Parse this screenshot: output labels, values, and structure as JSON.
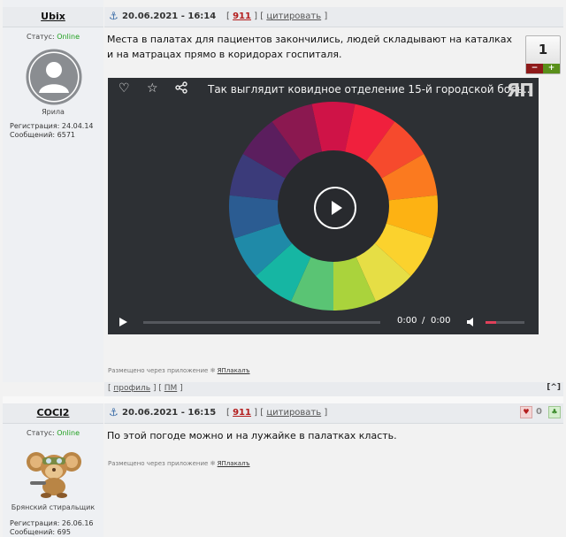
{
  "post1": {
    "nick": "Ubix",
    "status_label": "Статус:",
    "status_value": "Online",
    "rank": "Ярила",
    "reg_label": "Регистрация: 24.04.14",
    "msgs_label": "Сообщений: 6571",
    "date": "20.06.2021 - 16:14",
    "num": "911",
    "cite": "цитировать",
    "text": "Места в палатах для пациентов закончились, людей складывают на каталках и на матрацах прямо в коридорах госпиталя.",
    "rating": "1",
    "minus": "−",
    "plus": "+",
    "video": {
      "title": "Так выглядит ковидное отделение 15-й городской боль...",
      "logo": "ЯП",
      "time_current": "0:00",
      "time_sep": "/",
      "time_total": "0:00",
      "icons": [
        "heart-icon",
        "star-icon",
        "share-icon",
        "play-icon",
        "volume-icon",
        "fullscreen-icon"
      ]
    },
    "posted_via_prefix": "Размещено через приложение",
    "app_name": "ЯПлакалъ",
    "footer_profile": "профиль",
    "footer_pm": "ПМ",
    "up": "[^]"
  },
  "post2": {
    "nick": "COCl2",
    "status_label": "Статус:",
    "status_value": "Online",
    "rank": "Брянский стиральщик",
    "reg_label": "Регистрация: 26.06.16",
    "msgs_label": "Сообщений: 695",
    "date": "20.06.2021 - 16:15",
    "num": "911",
    "cite": "цитировать",
    "text": "По этой погоде можно и на лужайке в палатках класть.",
    "rating": "0",
    "posted_via_prefix": "Размещено через приложение",
    "app_name": "ЯПлакалъ"
  },
  "colors": {
    "online": "#21a121",
    "link_red": "#b31d1d",
    "video_bg": "#2d3034",
    "wheel": [
      "#cf1347",
      "#f0203d",
      "#f64a2d",
      "#fb7a1f",
      "#fdb213",
      "#fbd22d",
      "#e6de45",
      "#aad33c",
      "#5ac474",
      "#16b6a3",
      "#1f8aa8",
      "#2b5c92",
      "#3b3b7a",
      "#5b1e5e",
      "#8b1850"
    ]
  }
}
